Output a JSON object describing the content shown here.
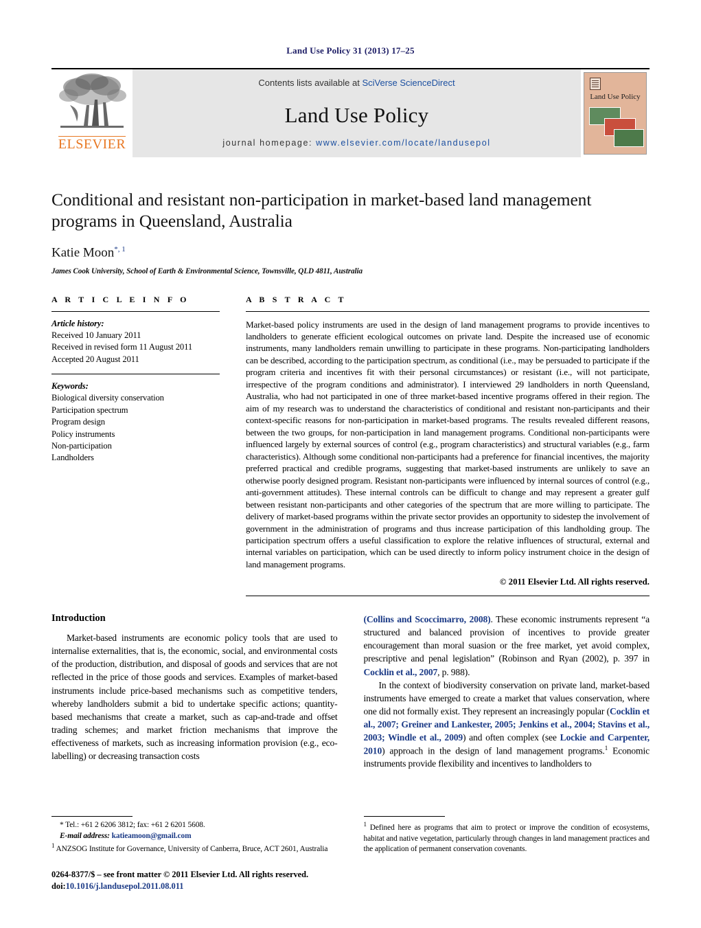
{
  "running_head": "Land Use Policy 31 (2013) 17–25",
  "masthead": {
    "publisher_name": "ELSEVIER",
    "contents_prefix": "Contents lists available at ",
    "contents_link": "SciVerse ScienceDirect",
    "journal_title": "Land Use Policy",
    "homepage_label": "journal homepage: ",
    "homepage_url": "www.elsevier.com/locate/landusepol",
    "cover_title": "Land Use Policy",
    "link_color": "#1b4fa0",
    "elsevier_orange": "#E87722"
  },
  "article": {
    "title": "Conditional and resistant non-participation in market-based land management programs in Queensland, Australia",
    "author": "Katie Moon",
    "author_marks": "*, 1",
    "affiliation": "James Cook University, School of Earth & Environmental Science, Townsville, QLD 4811, Australia"
  },
  "article_info": {
    "heading": "A R T I C L E    I N F O",
    "history_label": "Article history:",
    "history": [
      "Received 10 January 2011",
      "Received in revised form 11 August 2011",
      "Accepted 20 August 2011"
    ],
    "keywords_label": "Keywords:",
    "keywords": [
      "Biological diversity conservation",
      "Participation spectrum",
      "Program design",
      "Policy instruments",
      "Non-participation",
      "Landholders"
    ]
  },
  "abstract": {
    "heading": "A B S T R A C T",
    "text": "Market-based policy instruments are used in the design of land management programs to provide incentives to landholders to generate efficient ecological outcomes on private land. Despite the increased use of economic instruments, many landholders remain unwilling to participate in these programs. Non-participating landholders can be described, according to the participation spectrum, as conditional (i.e., may be persuaded to participate if the program criteria and incentives fit with their personal circumstances) or resistant (i.e., will not participate, irrespective of the program conditions and administrator). I interviewed 29 landholders in north Queensland, Australia, who had not participated in one of three market-based incentive programs offered in their region. The aim of my research was to understand the characteristics of conditional and resistant non-participants and their context-specific reasons for non-participation in market-based programs. The results revealed different reasons, between the two groups, for non-participation in land management programs. Conditional non-participants were influenced largely by external sources of control (e.g., program characteristics) and structural variables (e.g., farm characteristics). Although some conditional non-participants had a preference for financial incentives, the majority preferred practical and credible programs, suggesting that market-based instruments are unlikely to save an otherwise poorly designed program. Resistant non-participants were influenced by internal sources of control (e.g., anti-government attitudes). These internal controls can be difficult to change and may represent a greater gulf between resistant non-participants and other categories of the spectrum that are more willing to participate. The delivery of market-based programs within the private sector provides an opportunity to sidestep the involvement of government in the administration of programs and thus increase participation of this landholding group. The participation spectrum offers a useful classification to explore the relative influences of structural, external and internal variables on participation, which can be used directly to inform policy instrument choice in the design of land management programs.",
    "copyright": "© 2011 Elsevier Ltd. All rights reserved."
  },
  "introduction": {
    "heading": "Introduction",
    "left_para_1": "Market-based instruments are economic policy tools that are used to internalise externalities, that is, the economic, social, and environmental costs of the production, distribution, and disposal of goods and services that are not reflected in the price of those goods and services. Examples of market-based instruments include price-based mechanisms such as competitive tenders, whereby landholders submit a bid to undertake specific actions; quantity-based mechanisms that create a market, such as cap-and-trade and offset trading schemes; and market friction mechanisms that improve the effectiveness of markets, such as increasing information provision (e.g., eco-labelling) or decreasing transaction costs",
    "right_para_1_a": "(Collins and Scoccimarro, 2008)",
    "right_para_1_b": ". These economic instruments represent “a structured and balanced provision of incentives to provide greater encouragement than moral suasion or the free market, yet avoid complex, prescriptive and penal legislation” (Robinson and Ryan (2002), p. 397 in ",
    "right_para_1_c": "Cocklin et al., 2007",
    "right_para_1_d": ", p. 988).",
    "right_para_2_a": "In the context of biodiversity conservation on private land, market-based instruments have emerged to create a market that values conservation, where one did not formally exist. They represent an increasingly popular (",
    "right_para_2_b": "Cocklin et al., 2007; Greiner and Lankester, 2005; Jenkins et al., 2004; Stavins et al., 2003; Windle et al., 2009",
    "right_para_2_c": ") and often complex (see ",
    "right_para_2_d": "Lockie and Carpenter, 2010",
    "right_para_2_e": ") approach in the design of land management programs.",
    "right_para_2_f": " Economic instruments provide flexibility and incentives to landholders to"
  },
  "footnotes": {
    "corresponding": "* Tel.: +61 2 6206 3812; fax: +61 2 6201 5608.",
    "email_label": "E-mail address: ",
    "email": "katieamoon@gmail.com",
    "affiliation_note_mark": "1",
    "affiliation_note": " ANZSOG Institute for Governance, University of Canberra, Bruce, ACT 2601, Australia",
    "right_note_mark": "1",
    "right_note": " Defined here as programs that aim to protect or improve the condition of ecosystems, habitat and native vegetation, particularly through changes in land management practices and the application of permanent conservation covenants.",
    "issn_line": "0264-8377/$ – see front matter © 2011 Elsevier Ltd. All rights reserved.",
    "doi_label": "doi:",
    "doi": "10.1016/j.landusepol.2011.08.011"
  }
}
